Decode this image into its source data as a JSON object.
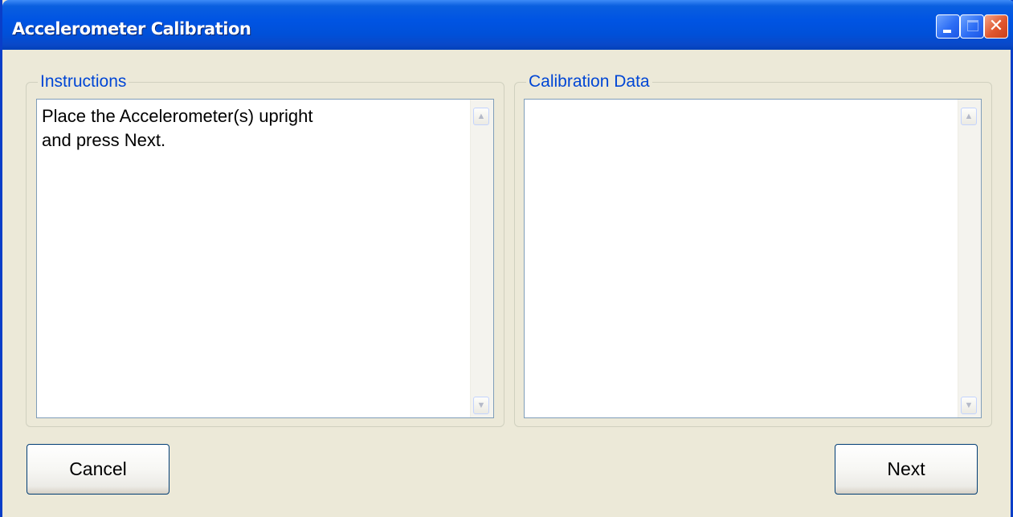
{
  "window": {
    "title": "Accelerometer Calibration",
    "controls": {
      "minimize_icon": "minimize-icon",
      "maximize_icon": "maximize-icon",
      "close_icon": "close-icon",
      "close_glyph": "✕"
    }
  },
  "instructions": {
    "label": "Instructions",
    "lines": [
      "Place the Accelerometer(s) upright",
      "and press Next."
    ]
  },
  "calibration_data": {
    "label": "Calibration Data",
    "text": ""
  },
  "scroll_arrows": {
    "up": "▲",
    "down": "▼"
  },
  "buttons": {
    "cancel_label": "Cancel",
    "next_label": "Next"
  },
  "colors": {
    "titlebar": "#0054e3",
    "group_label": "#0046d5",
    "window_bg": "#ece9d8"
  }
}
